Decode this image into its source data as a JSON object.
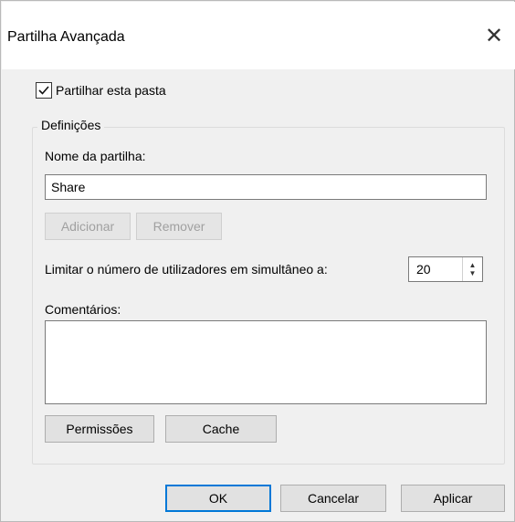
{
  "window": {
    "title": "Partilha Avançada",
    "close_glyph": "✕"
  },
  "share": {
    "checkbox_label": "Partilhar esta pasta",
    "checked": true,
    "check_glyph": "✓"
  },
  "settings": {
    "group_label": "Definições",
    "share_name_label": "Nome da partilha:",
    "share_name_value": "Share",
    "add_label": "Adicionar",
    "remove_label": "Remover",
    "limit_label": "Limitar o número de utilizadores em simultâneo a:",
    "limit_value": "20",
    "comments_label": "Comentários:",
    "comments_value": "",
    "permissions_label": "Permissões",
    "cache_label": "Cache"
  },
  "footer": {
    "ok_label": "OK",
    "cancel_label": "Cancelar",
    "apply_label": "Aplicar"
  },
  "colors": {
    "accent": "#0078d7",
    "background": "#f0f0f0"
  }
}
